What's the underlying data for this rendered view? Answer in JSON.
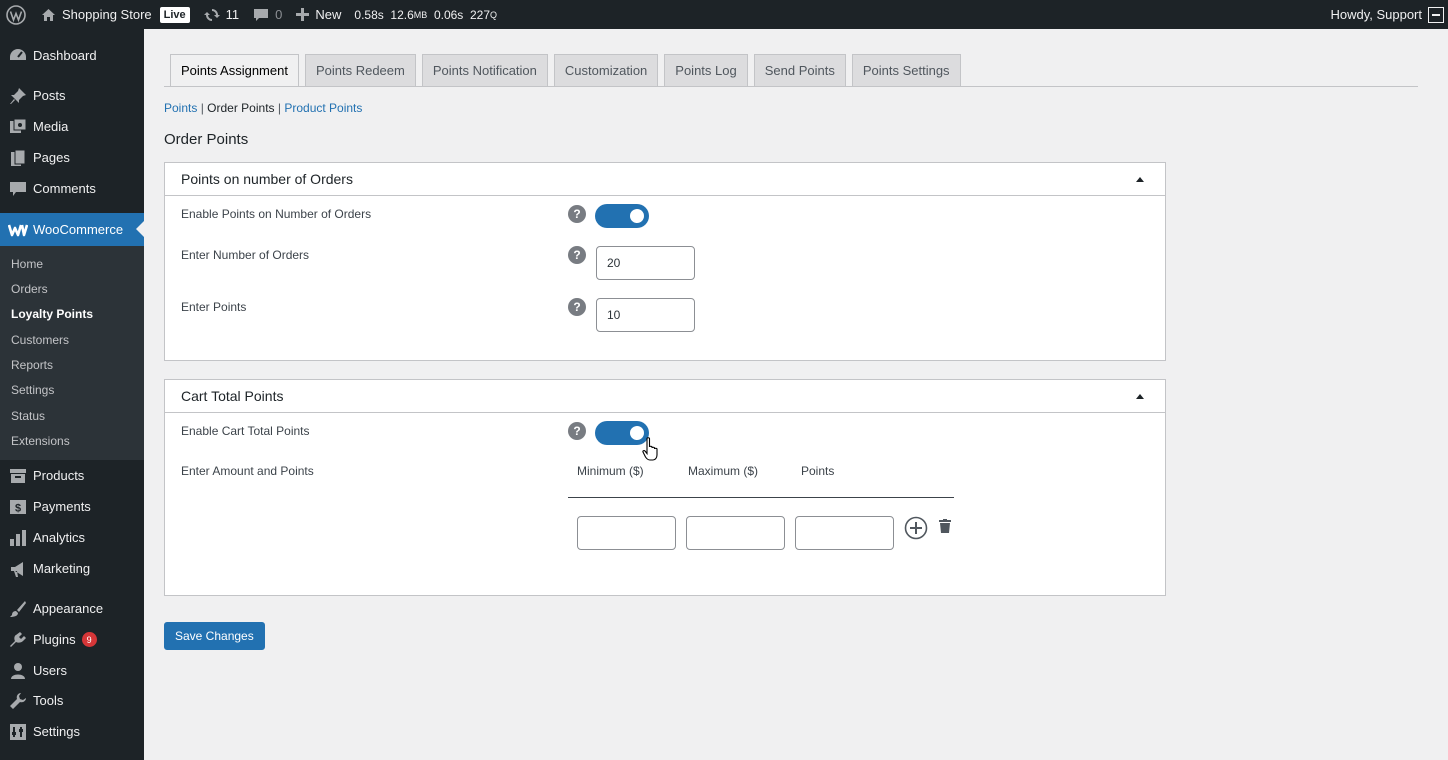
{
  "adminbar": {
    "site_name": "Shopping Store",
    "live_label": "Live",
    "updates_count": "11",
    "comments_count": "0",
    "new_label": "New",
    "perf_time": "0.58s",
    "perf_mem": "12.6",
    "perf_mem_unit": "MB",
    "perf_query_time": "0.06s",
    "perf_queries": "227",
    "perf_queries_unit": "Q",
    "howdy": "Howdy, Support"
  },
  "sidebar": {
    "dashboard": "Dashboard",
    "posts": "Posts",
    "media": "Media",
    "pages": "Pages",
    "comments": "Comments",
    "woocommerce": "WooCommerce",
    "sub": [
      "Home",
      "Orders",
      "Loyalty Points",
      "Customers",
      "Reports",
      "Settings",
      "Status",
      "Extensions"
    ],
    "products": "Products",
    "payments": "Payments",
    "analytics": "Analytics",
    "marketing": "Marketing",
    "appearance": "Appearance",
    "plugins": "Plugins",
    "plugins_badge": "9",
    "users": "Users",
    "tools": "Tools",
    "settings": "Settings"
  },
  "tabs": [
    "Points Assignment",
    "Points Redeem",
    "Points Notification",
    "Customization",
    "Points Log",
    "Send Points",
    "Points Settings"
  ],
  "subnav": {
    "points": "Points",
    "sep": "|",
    "order_points": "Order Points",
    "product_points": "Product Points"
  },
  "page_heading": "Order Points",
  "orders_section": {
    "title": "Points on number of Orders",
    "enable_label": "Enable Points on Number of Orders",
    "enabled": true,
    "num_orders_label": "Enter Number of Orders",
    "num_orders_value": "20",
    "points_label": "Enter Points",
    "points_value": "10"
  },
  "cart_section": {
    "title": "Cart Total Points",
    "enable_label": "Enable Cart Total Points",
    "enabled": true,
    "amount_label": "Enter Amount and Points",
    "col_min": "Minimum ($)",
    "col_max": "Maximum ($)",
    "col_points": "Points",
    "row_values": [
      "",
      "",
      ""
    ]
  },
  "help_glyph": "?",
  "save_label": "Save Changes",
  "colors": {
    "accent": "#2271b1",
    "sidebar_bg": "#1d2327",
    "submenu_bg": "#2c3338",
    "badge": "#d63638"
  }
}
